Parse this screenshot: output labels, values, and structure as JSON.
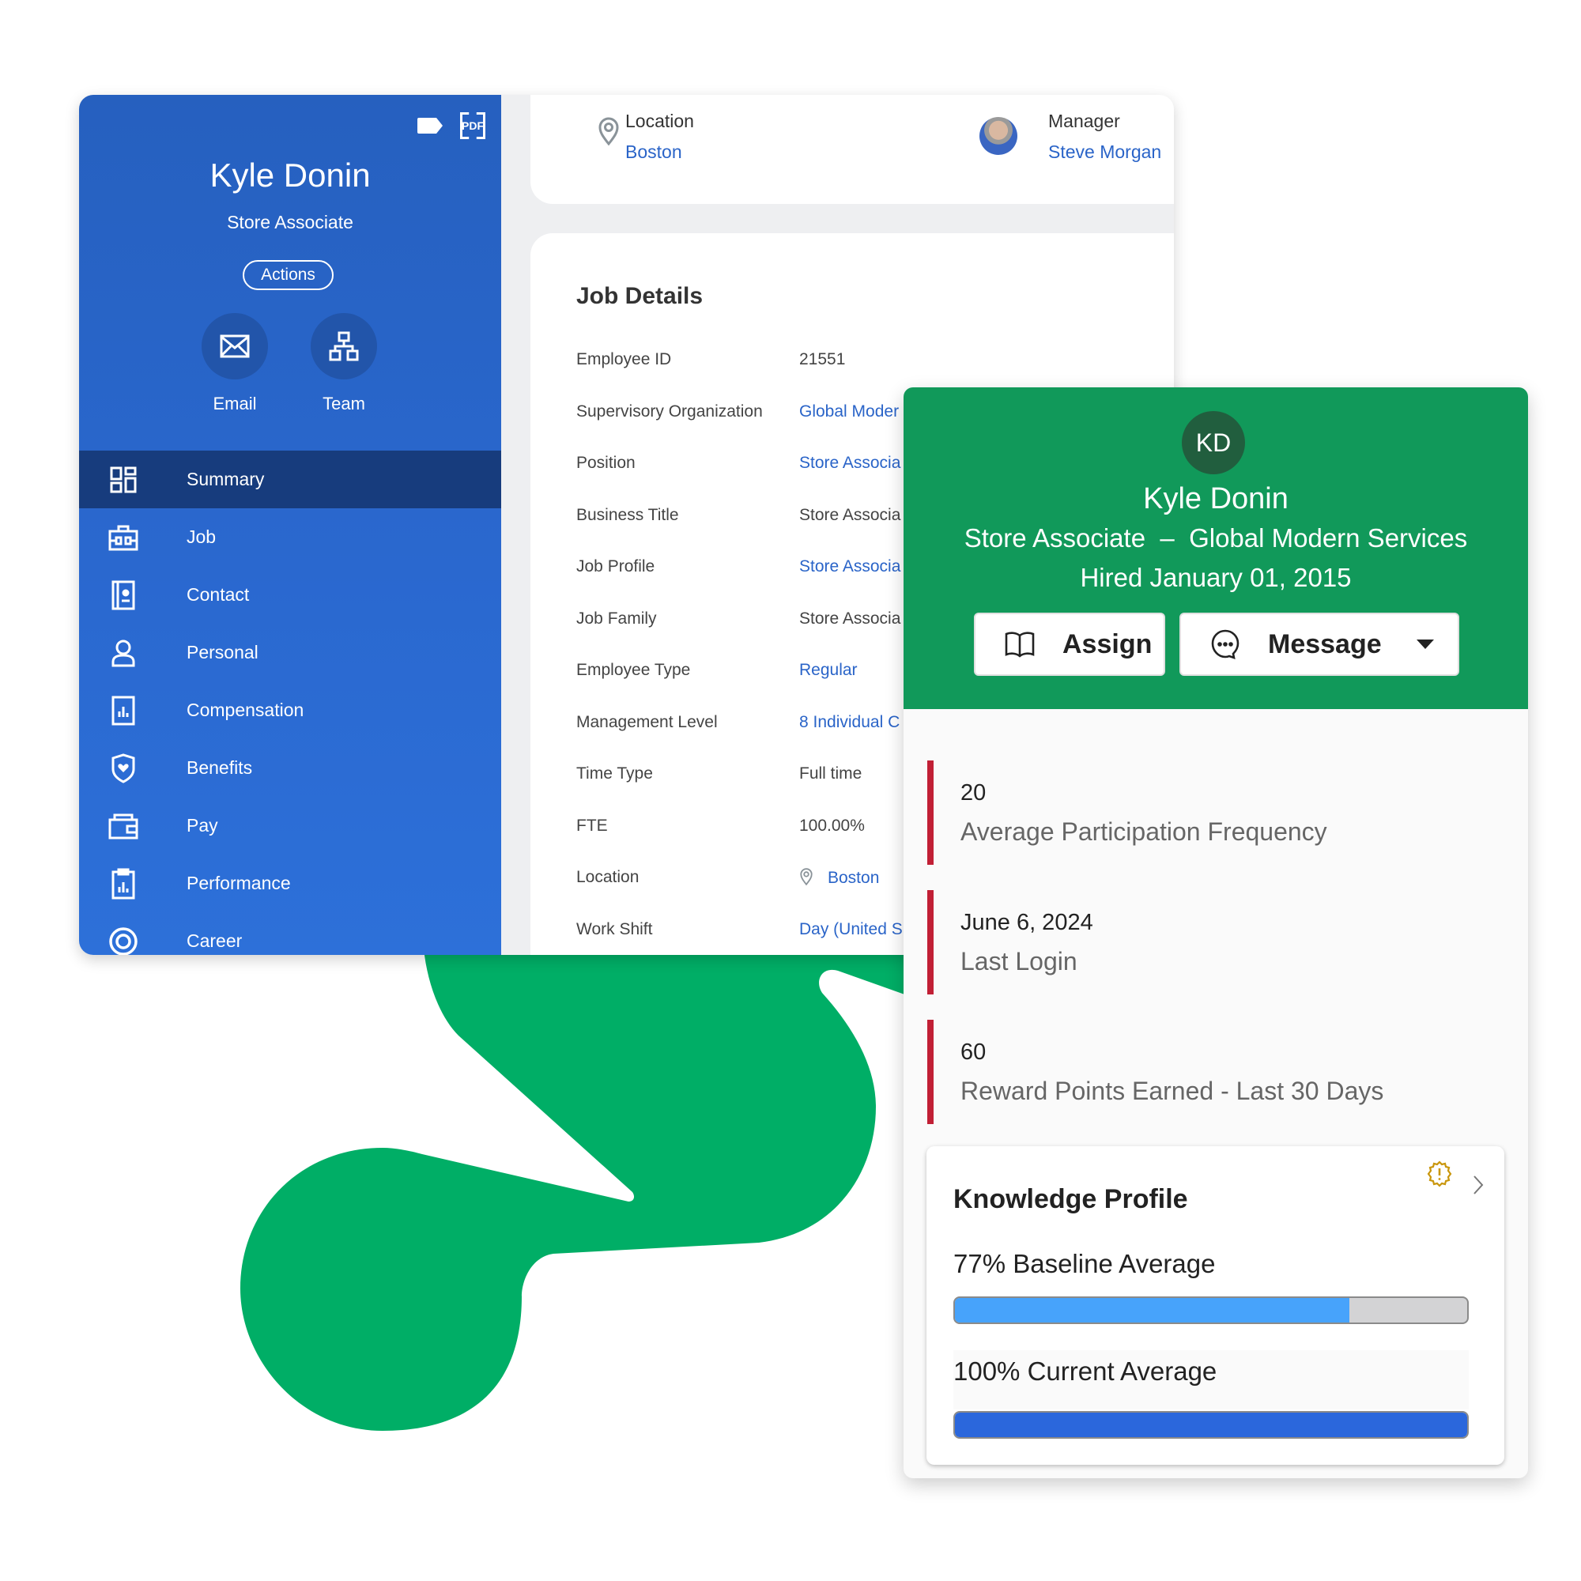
{
  "profile_panel": {
    "top_icons": [
      "tag-icon",
      "pdf-icon"
    ],
    "pdf_label": "PDF",
    "name": "Kyle Donin",
    "title": "Store Associate",
    "actions_label": "Actions",
    "quick_actions": [
      {
        "label": "Email",
        "icon": "envelope-icon"
      },
      {
        "label": "Team",
        "icon": "org-chart-icon"
      }
    ],
    "nav": [
      {
        "label": "Summary",
        "icon": "dashboard-icon",
        "active": true
      },
      {
        "label": "Job",
        "icon": "briefcase-icon",
        "active": false
      },
      {
        "label": "Contact",
        "icon": "contact-card-icon",
        "active": false
      },
      {
        "label": "Personal",
        "icon": "person-icon",
        "active": false
      },
      {
        "label": "Compensation",
        "icon": "chart-document-icon",
        "active": false
      },
      {
        "label": "Benefits",
        "icon": "shield-heart-icon",
        "active": false
      },
      {
        "label": "Pay",
        "icon": "wallet-icon",
        "active": false
      },
      {
        "label": "Performance",
        "icon": "clipboard-chart-icon",
        "active": false
      },
      {
        "label": "Career",
        "icon": "target-icon",
        "active": false
      }
    ]
  },
  "summary_header": {
    "location_label": "Location",
    "location_value": "Boston",
    "manager_label": "Manager",
    "manager_value": "Steve Morgan"
  },
  "job_details": {
    "title": "Job Details",
    "rows": [
      {
        "label": "Employee ID",
        "value": "21551",
        "link": false
      },
      {
        "label": "Supervisory Organization",
        "value": "Global Moder",
        "link": true
      },
      {
        "label": "Position",
        "value": "Store Associa",
        "link": true
      },
      {
        "label": "Business Title",
        "value": "Store Associa",
        "link": false
      },
      {
        "label": "Job Profile",
        "value": "Store Associa",
        "link": true
      },
      {
        "label": "Job Family",
        "value": "Store Associa",
        "link": false
      },
      {
        "label": "Employee Type",
        "value": "Regular",
        "link": true
      },
      {
        "label": "Management Level",
        "value": "8 Individual C",
        "link": true
      },
      {
        "label": "Time Type",
        "value": "Full time",
        "link": false
      },
      {
        "label": "FTE",
        "value": "100.00%",
        "link": false
      },
      {
        "label": "Location",
        "value": "Boston",
        "link": true,
        "icon": "location-pin-icon"
      },
      {
        "label": "Work Shift",
        "value": "Day (United S",
        "link": true
      }
    ]
  },
  "learner_card": {
    "initials": "KD",
    "name": "Kyle Donin",
    "subtitle": "Store Associate  –  Global Modern Services",
    "hired": "Hired January 01, 2015",
    "assign_label": "Assign",
    "message_label": "Message",
    "metrics": [
      {
        "value": "20",
        "label": "Average Participation Frequency"
      },
      {
        "value": "June 6, 2024",
        "label": "Last Login"
      },
      {
        "value": "60",
        "label": "Reward Points Earned - Last 30 Days"
      }
    ],
    "knowledge_profile": {
      "title": "Knowledge Profile",
      "baseline_label": "77% Baseline Average",
      "baseline_percent": 77,
      "current_label": "100% Current Average",
      "current_percent": 100
    }
  },
  "colors": {
    "sidebar_blue": "#2a68cf",
    "sidebar_active": "#173c7d",
    "link_blue": "#2a64c8",
    "header_green": "#11995a",
    "brand_green": "#00ae66",
    "metric_red": "#c11f35",
    "baseline_bar": "#47a3fb",
    "current_bar": "#2b67dc"
  }
}
